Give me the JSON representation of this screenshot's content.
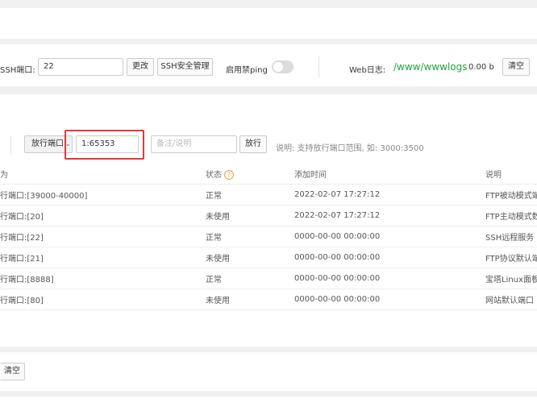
{
  "ssh": {
    "port_label": "SSH端口:",
    "port_value": "22",
    "change_button": "更改",
    "manage_button": "SSH安全管理",
    "ping_label": "启用禁ping"
  },
  "weblog": {
    "label": "Web日志:",
    "path": "/www/wwwlogs",
    "size": "0.00 b",
    "clear_button": "清空"
  },
  "firewall": {
    "action_select": "放行端口",
    "port_input": "1:65353",
    "note_placeholder": "备注/说明",
    "submit_button": "放行",
    "hint": "说明: 支持放行端口范围, 如: 3000:3500"
  },
  "table": {
    "headers": {
      "behavior": "为",
      "status": "状态",
      "time": "添加时间",
      "note": "说明"
    },
    "rows": [
      {
        "behavior": "行端口:[39000-40000]",
        "status": "正常",
        "time": "2022-02-07 17:27:12",
        "note": "FTP被动模式端口"
      },
      {
        "behavior": "行端口:[20]",
        "status": "未使用",
        "time": "2022-02-07 17:27:12",
        "note": "FTP主动模式数据"
      },
      {
        "behavior": "行端口:[22]",
        "status": "正常",
        "time": "0000-00-00 00:00:00",
        "note": "SSH远程服务"
      },
      {
        "behavior": "行端口:[21]",
        "status": "未使用",
        "time": "0000-00-00 00:00:00",
        "note": "FTP协议默认端口"
      },
      {
        "behavior": "行端口:[8888]",
        "status": "正常",
        "time": "0000-00-00 00:00:00",
        "note": "宝塔Linux面板默认"
      },
      {
        "behavior": "行端口:[80]",
        "status": "未使用",
        "time": "0000-00-00 00:00:00",
        "note": "网站默认端口"
      }
    ]
  },
  "bottom": {
    "clear_button": "清空"
  },
  "colors": {
    "log_path": "#20a53a",
    "highlight": "#e03a3a",
    "help_icon": "#f0a040"
  }
}
